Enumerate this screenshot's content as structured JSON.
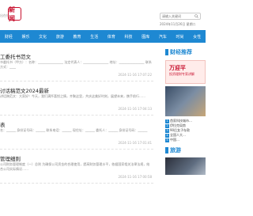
{
  "header": {
    "small_link": "出在线",
    "logo_text": "新闻",
    "search_placeholder": "请输入关键词",
    "date_text": "2024年11月26日 星期二"
  },
  "nav": {
    "items": [
      "财经",
      "娱乐",
      "文化",
      "旅游",
      "教育",
      "生活",
      "体育",
      "科技",
      "图库",
      "汽车",
      "时尚",
      "女性"
    ]
  },
  "articles": [
    {
      "title": "工委托书范文",
      "summary": "书委托书（甲方）：名称：________________ 法定代表人：________________ 地址：________________ 联系方式：____",
      "time": "2024-11-16 17:07:22"
    },
    {
      "title": "讨话稿范文2024最新",
      "summary": "讲话稿范文：大家好！今天，我们满怀喜悦之情，齐聚这里，共庆这美好时刻，展望未来，携手前行……",
      "time": "2024-11-16 17:04:13"
    },
    {
      "title": "表",
      "summary": "名：______ 身份证号码：______ 联系电话：______ 现住址：______ 委托人：______ 身份证号码：______",
      "time": "2024-11-16 17:01:41"
    },
    {
      "title": "管理细则",
      "summary": "公司财务管理制度（一）总则 为确保公司资金的合理使用，提高财务管理水平，依据国家相关法律法规，结合公司实际情况……",
      "time": "2024-11-16 17:00:58"
    }
  ],
  "sidebar": {
    "section_title": "财经推荐",
    "banner_title": "万迎平",
    "banner_sub": "投资理财专家讲解",
    "list": [
      "首家科技城市…",
      "伊拉克局势",
      "90后女子存款",
      "全国人大…",
      "中国…"
    ],
    "section2_title": "旅游"
  }
}
